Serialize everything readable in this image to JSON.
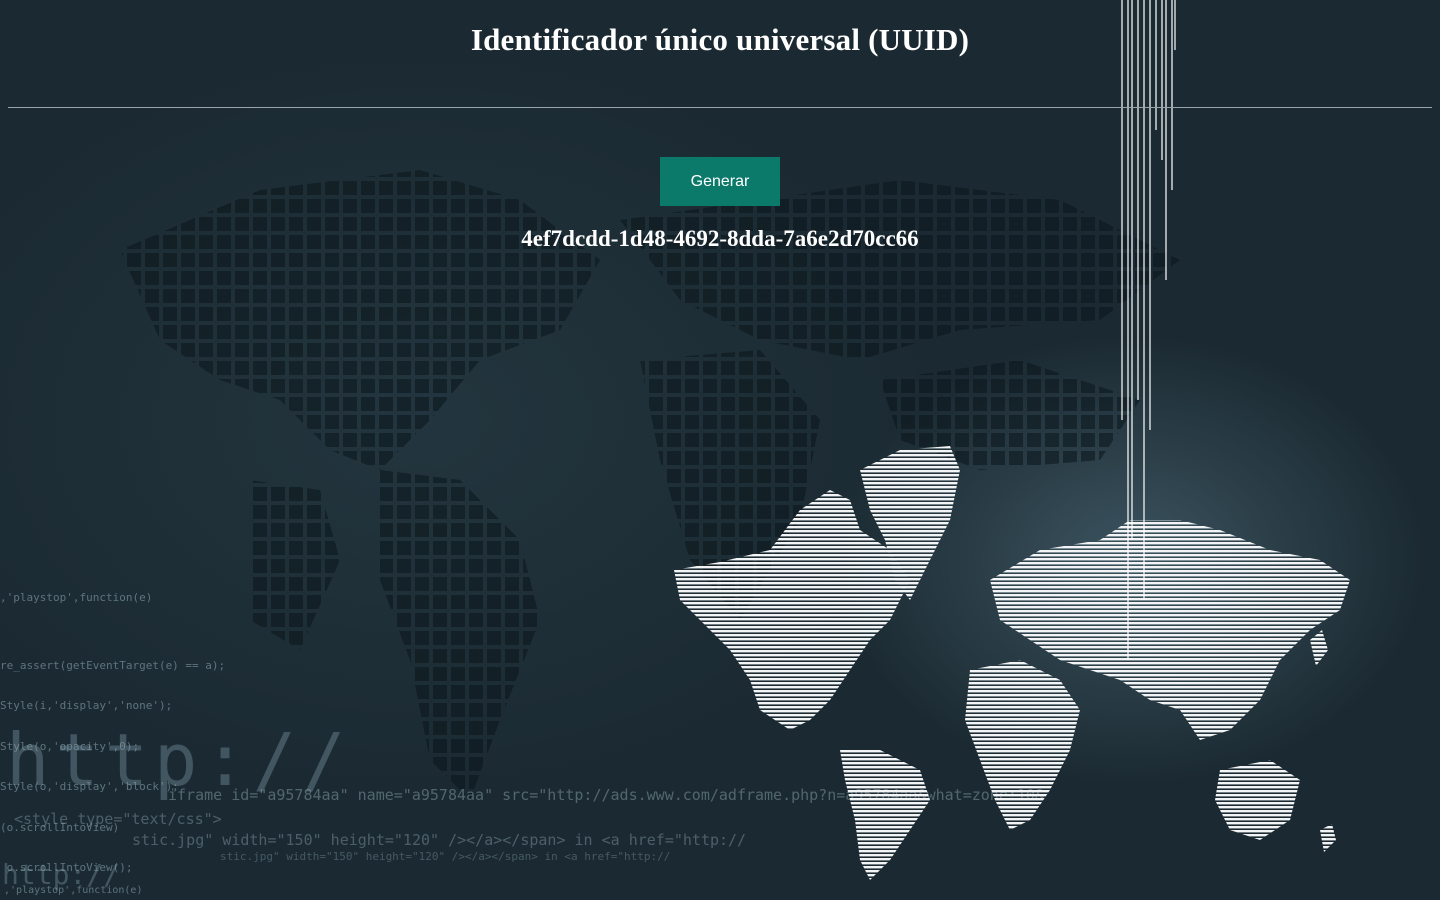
{
  "page": {
    "title": "Identificador único universal (UUID)"
  },
  "actions": {
    "generate_label": "Generar"
  },
  "result": {
    "uuid": "4ef7dcdd-1d48-4692-8dda-7a6e2d70cc66"
  },
  "background": {
    "code_lines": [
      ",'playstop',function(e)",
      "",
      "re_assert(getEventTarget(e) == a);",
      "Style(i,'display','none');",
      "Style(o,'opacity',0);",
      "Style(o,'display','block');",
      "(o.scrollIntoView)",
      " o.scrollIntoView();"
    ],
    "http_big": "http://",
    "iframe_line": "iframe id=\"a95784aa\" name=\"a95784aa\" src=\"http://ads.www.com/adframe.php?n=a95784aa&what=zone:10&",
    "style_line": "<style type=\"text/css\">",
    "stic_line": "stic.jpg\" width=\"150\" height=\"120\" /></a></span> in <a href=\"http://",
    "stic_line_small": "stic.jpg\" width=\"150\" height=\"120\" /></a></span> in <a href=\"http://",
    "http_small": "http://",
    "playstop_small": ",'playstop',function(e)"
  },
  "colors": {
    "background": "#1b2a32",
    "button": "#0b7a6a",
    "text": "#ffffff"
  }
}
